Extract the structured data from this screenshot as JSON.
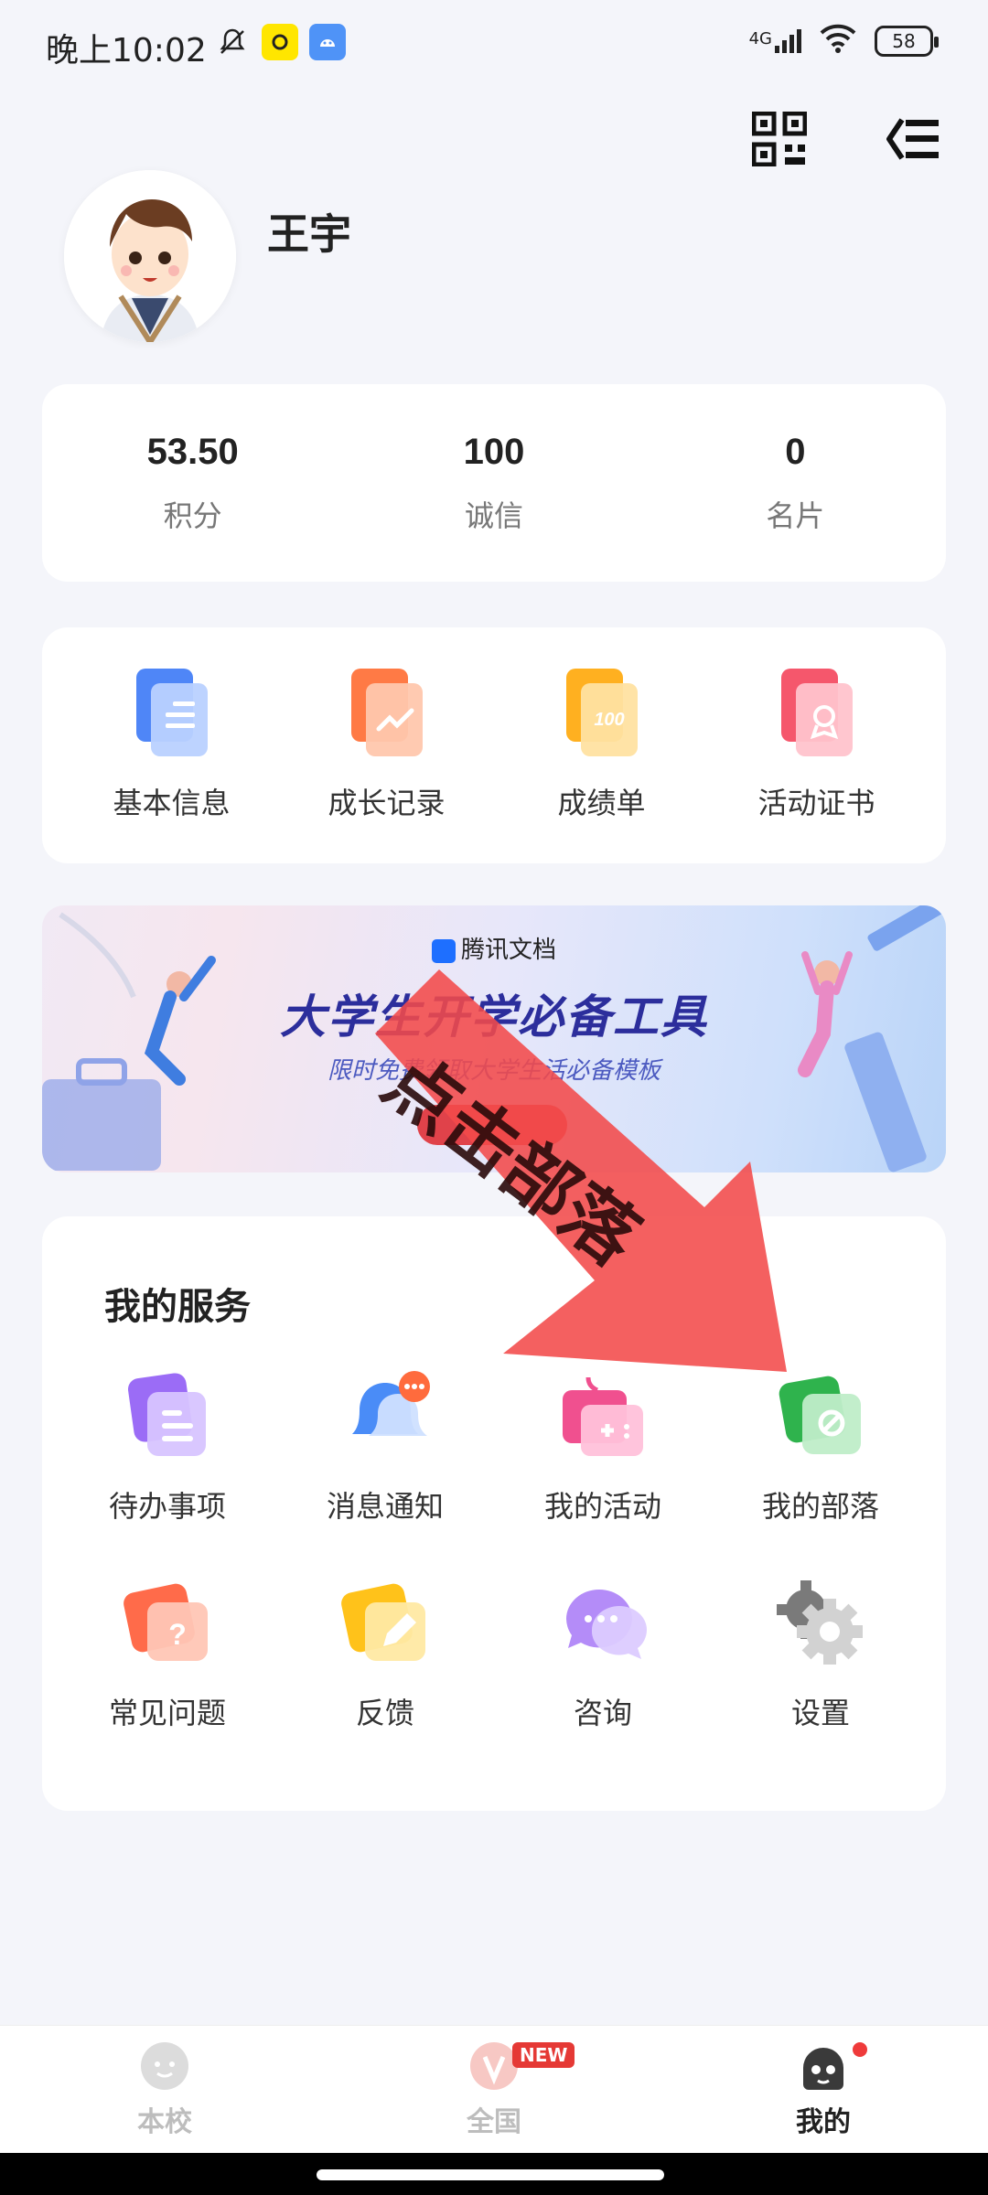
{
  "status_bar": {
    "time": "晚上10:02",
    "network": "4G",
    "battery": "58"
  },
  "profile": {
    "name": "王宇"
  },
  "stats": [
    {
      "value": "53.50",
      "label": "积分"
    },
    {
      "value": "100",
      "label": "诚信"
    },
    {
      "value": "0",
      "label": "名片"
    }
  ],
  "quick": [
    {
      "label": "基本信息",
      "icon": "document-icon",
      "color": "#4f86f7"
    },
    {
      "label": "成长记录",
      "icon": "growth-chart-icon",
      "color": "#ff7a45"
    },
    {
      "label": "成绩单",
      "icon": "score-100-icon",
      "color": "#ffb020"
    },
    {
      "label": "活动证书",
      "icon": "certificate-icon",
      "color": "#f5576c"
    }
  ],
  "banner": {
    "brand": "腾讯文档",
    "title": "大学生开学必备工具",
    "subtitle": "限时免费领取大学生活必备模板"
  },
  "services": {
    "title": "我的服务",
    "items": [
      {
        "label": "待办事项",
        "icon": "todo-icon",
        "color": "#9b6cf6"
      },
      {
        "label": "消息通知",
        "icon": "bell-icon",
        "color": "#4a8cf7"
      },
      {
        "label": "我的活动",
        "icon": "activity-icon",
        "color": "#f0508f"
      },
      {
        "label": "我的部落",
        "icon": "tribe-icon",
        "color": "#3bbf57"
      },
      {
        "label": "常见问题",
        "icon": "question-icon",
        "color": "#ff6b4a"
      },
      {
        "label": "反馈",
        "icon": "feedback-pencil-icon",
        "color": "#ffc21a"
      },
      {
        "label": "咨询",
        "icon": "chat-bubble-icon",
        "color": "#a57bf5"
      },
      {
        "label": "设置",
        "icon": "gear-icon",
        "color": "#888888"
      }
    ]
  },
  "overlay": {
    "text": "点击部落",
    "color": "#f24a4a"
  },
  "bottom_nav": [
    {
      "label": "本校",
      "icon": "school-icon",
      "active": false
    },
    {
      "label": "全国",
      "icon": "national-icon",
      "active": false,
      "badge": "NEW"
    },
    {
      "label": "我的",
      "icon": "mine-icon",
      "active": true
    }
  ]
}
